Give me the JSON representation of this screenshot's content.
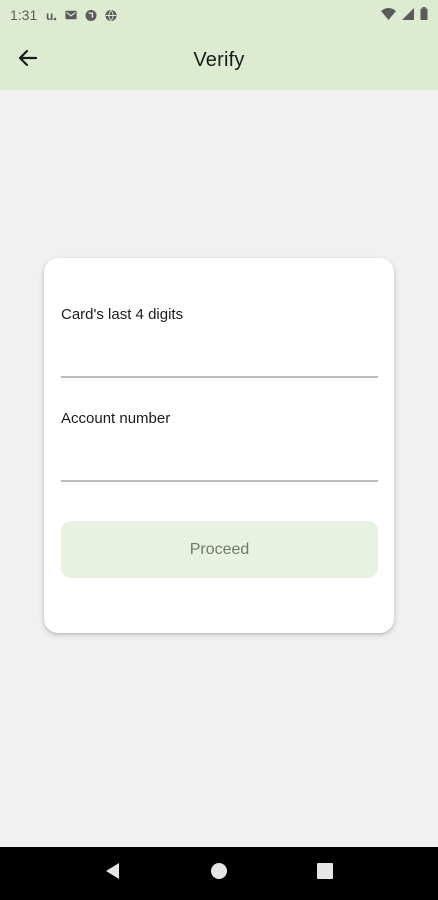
{
  "status_bar": {
    "time": "1:31",
    "notification_icons": [
      "u-icon",
      "mail-icon",
      "tracking-icon",
      "globe-icon"
    ]
  },
  "app_bar": {
    "title": "Verify",
    "back_icon": "arrow-left-icon"
  },
  "form": {
    "card_digits_label": "Card's last 4 digits",
    "card_digits_value": "",
    "account_number_label": "Account number",
    "account_number_value": "",
    "proceed_label": "Proceed"
  },
  "colors": {
    "app_bar_bg": "#ddebd1",
    "page_bg": "#f1f1f1",
    "button_bg": "#e9f2e1",
    "button_text": "#6e7a6b"
  },
  "nav_bar": {
    "buttons": [
      "back-triangle-icon",
      "home-circle-icon",
      "recents-square-icon"
    ]
  }
}
